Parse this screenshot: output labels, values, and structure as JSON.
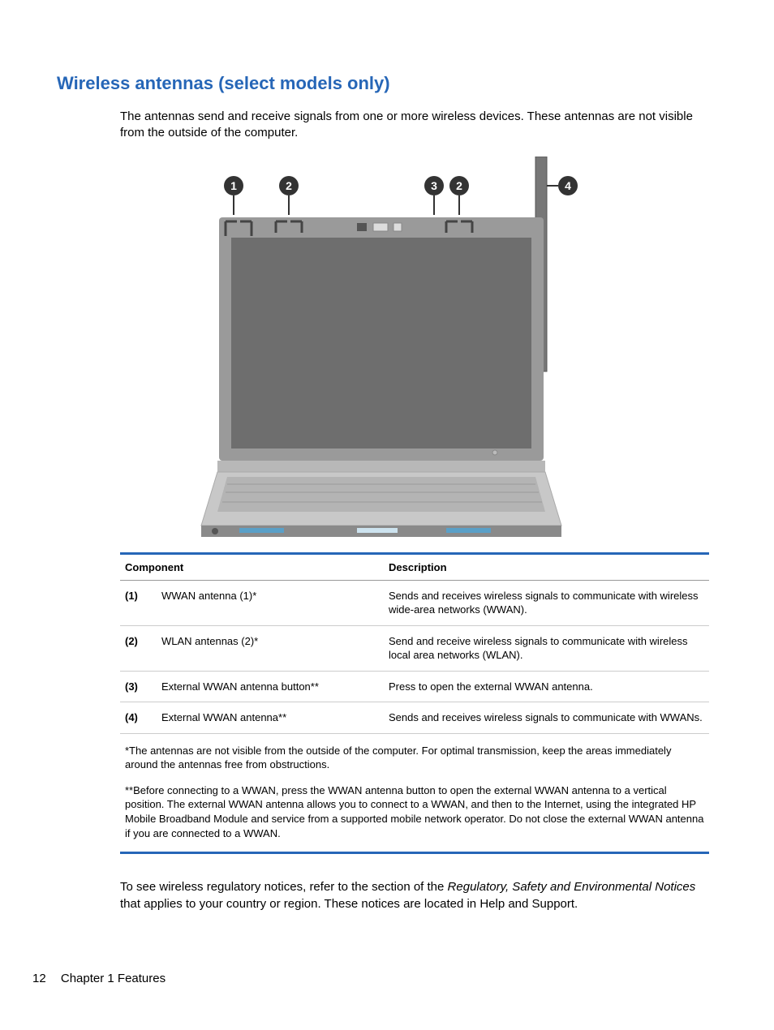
{
  "heading": "Wireless antennas (select models only)",
  "intro": "The antennas send and receive signals from one or more wireless devices. These antennas are not visible from the outside of the computer.",
  "table": {
    "headers": {
      "component": "Component",
      "description": "Description"
    },
    "rows": [
      {
        "num": "(1)",
        "component": "WWAN antenna (1)*",
        "description": "Sends and receives wireless signals to communicate with wireless wide-area networks (WWAN)."
      },
      {
        "num": "(2)",
        "component": "WLAN antennas (2)*",
        "description": "Send and receive wireless signals to communicate with wireless local area networks (WLAN)."
      },
      {
        "num": "(3)",
        "component": "External WWAN antenna button**",
        "description": "Press to open the external WWAN antenna."
      },
      {
        "num": "(4)",
        "component": "External WWAN antenna**",
        "description": "Sends and receives wireless signals to communicate with WWANs."
      }
    ],
    "footnote1": "*The antennas are not visible from the outside of the computer. For optimal transmission, keep the areas immediately around the antennas free from obstructions.",
    "footnote2": "**Before connecting to a WWAN, press the WWAN antenna button to open the external WWAN antenna to a vertical position. The external WWAN antenna allows you to connect to a WWAN, and then to the Internet, using the integrated HP Mobile Broadband Module and service from a supported mobile network operator. Do not close the external WWAN antenna if you are connected to a WWAN."
  },
  "closing": {
    "pre": "To see wireless regulatory notices, refer to the section of the ",
    "ital1": "Regulatory, Safety and Environmental Notices",
    "mid": " that applies to your country or region. These notices are located in Help and Support."
  },
  "footer": {
    "page": "12",
    "chapter": "Chapter 1   Features"
  }
}
